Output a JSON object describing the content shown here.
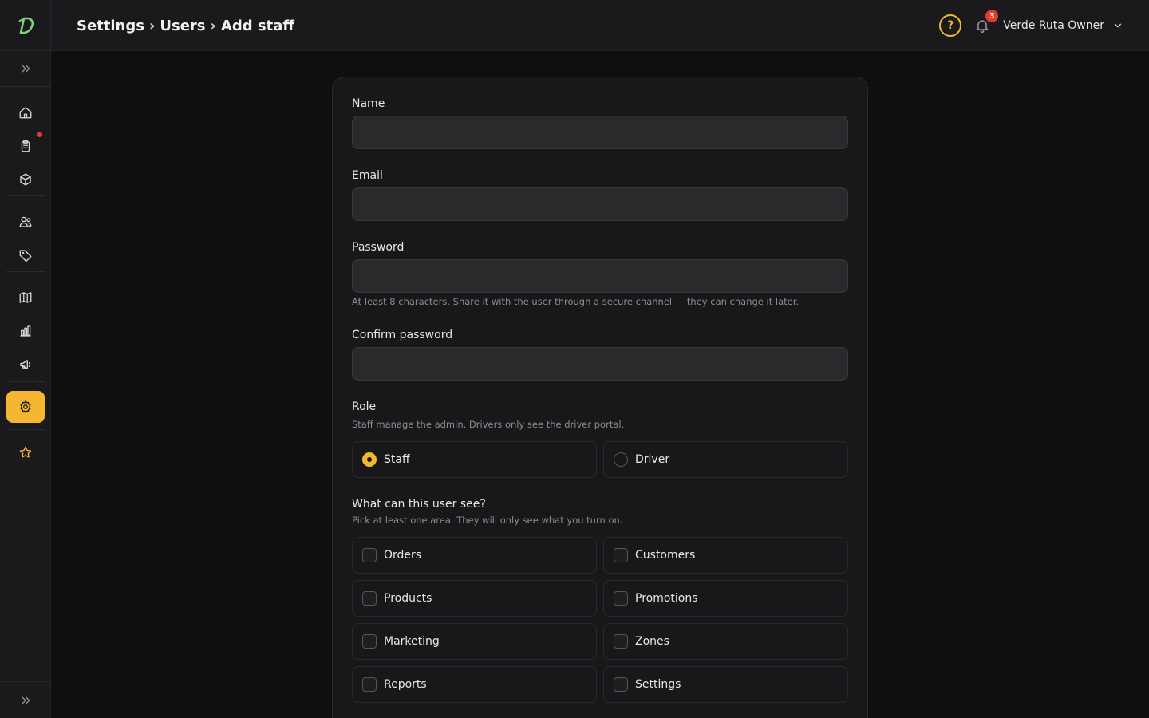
{
  "header": {
    "breadcrumb": [
      "Settings",
      "Users",
      "Add staff"
    ],
    "separator": "›",
    "notifications_count": "3",
    "user_name": "Verde Ruta Owner",
    "help_glyph": "?"
  },
  "sidebar": {
    "items": [
      {
        "icon": "home-icon"
      },
      {
        "icon": "clipboard-icon",
        "has_alert": true
      },
      {
        "icon": "box-icon"
      },
      {
        "icon": "users-icon"
      },
      {
        "icon": "tag-icon"
      },
      {
        "icon": "map-icon"
      },
      {
        "icon": "bar-chart-icon"
      },
      {
        "icon": "megaphone-icon"
      },
      {
        "icon": "settings-icon",
        "active": true
      },
      {
        "icon": "star-icon"
      }
    ]
  },
  "form": {
    "name_label": "Name",
    "name_value": "",
    "email_label": "Email",
    "email_value": "",
    "password_label": "Password",
    "password_value": "",
    "password_hint": "At least 8 characters. Share it with the user through a secure channel — they can change it later.",
    "confirm_label": "Confirm password",
    "confirm_value": "",
    "role_title": "Role",
    "role_hint": "Staff manage the admin. Drivers only see the driver portal.",
    "roles": [
      {
        "label": "Staff",
        "selected": true
      },
      {
        "label": "Driver",
        "selected": false
      }
    ],
    "areas_title": "What can this user see?",
    "areas_hint": "Pick at least one area. They will only see what you turn on.",
    "areas": [
      {
        "label": "Orders",
        "checked": false
      },
      {
        "label": "Customers",
        "checked": false
      },
      {
        "label": "Products",
        "checked": false
      },
      {
        "label": "Promotions",
        "checked": false
      },
      {
        "label": "Marketing",
        "checked": false
      },
      {
        "label": "Zones",
        "checked": false
      },
      {
        "label": "Reports",
        "checked": false
      },
      {
        "label": "Settings",
        "checked": false
      }
    ]
  },
  "colors": {
    "accent": "#f5b731",
    "alert": "#e53935",
    "background": "#0f0f10",
    "surface": "#1a1a1c"
  }
}
